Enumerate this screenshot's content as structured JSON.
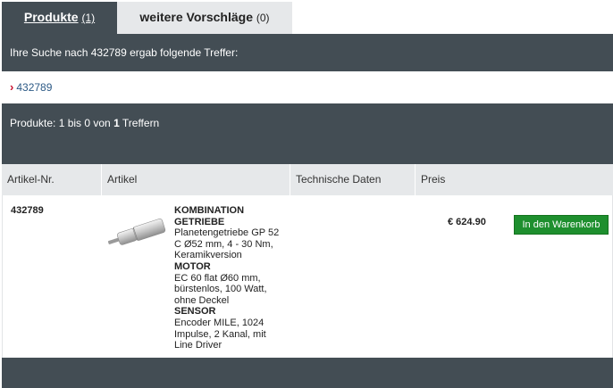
{
  "tabs": [
    {
      "label": "Produkte",
      "count": "(1)"
    },
    {
      "label": "weitere Vorschläge",
      "count": "(0)"
    }
  ],
  "search": {
    "message": "Ihre Suche nach 432789 ergab folgende Treffer:"
  },
  "suggestion": {
    "chevron": "›",
    "link": "432789"
  },
  "results": {
    "prefix": "Produkte: 1 bis 0 von ",
    "count": "1",
    "suffix": " Treffern"
  },
  "table": {
    "headers": [
      "Artikel-Nr.",
      "Artikel",
      "Technische Daten",
      "Preis"
    ],
    "row": {
      "article_number": "432789",
      "sections": [
        {
          "heading": "KOMBINATION GETRIEBE",
          "text": "Planetengetriebe GP 52 C Ø52 mm, 4 - 30 Nm, Keramikversion"
        },
        {
          "heading": "MOTOR",
          "text": "EC 60 flat Ø60 mm, bürstenlos, 100 Watt, ohne Deckel"
        },
        {
          "heading": "SENSOR",
          "text": "Encoder MILE, 1024 Impulse, 2 Kanal, mit Line Driver"
        }
      ],
      "price": "€ 624.90",
      "cart_label": "In den Warenkorb"
    }
  },
  "colors": {
    "dark_bar": "#434d54",
    "light_bar": "#e6e8ea",
    "accent_red": "#c8102e",
    "link_blue": "#2d5a86",
    "button_green": "#1e8f2e"
  }
}
